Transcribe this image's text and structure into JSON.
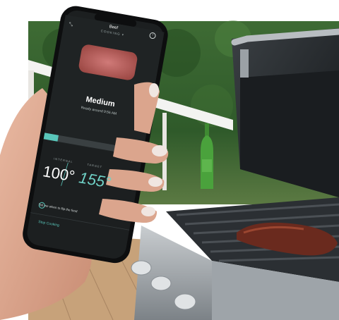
{
  "app": {
    "title": "Beef",
    "status": "COOKING ▾",
    "doneness": "Medium",
    "ready_time": "Ready around 9:56 AM",
    "internal_label": "INTERNAL",
    "target_label": "TARGET",
    "internal_temp": "100°",
    "target_temp": "155°",
    "flip_prompt": "Tell me when to flip the food",
    "stop_button": "Stop Cooking"
  },
  "colors": {
    "accent": "#59c6ba",
    "screen_bg": "#1c1f20",
    "foliage": "#2f5a2a",
    "grill": "#2a2d30"
  }
}
